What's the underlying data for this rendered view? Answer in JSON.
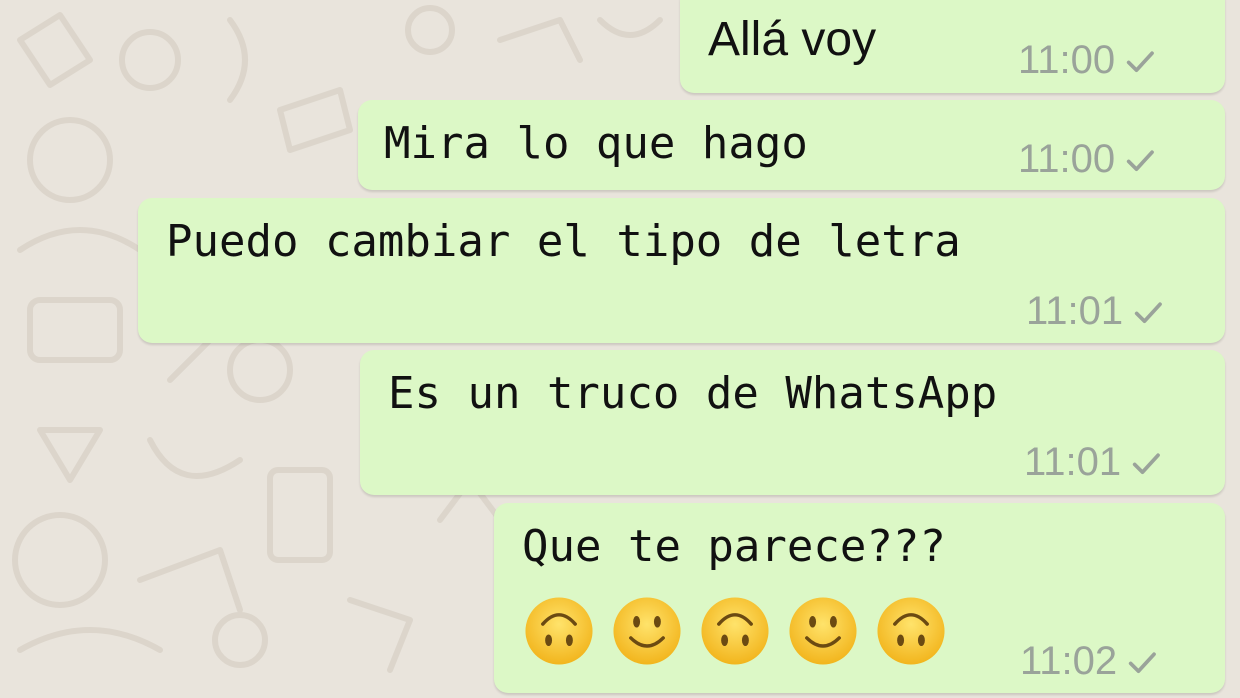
{
  "colors": {
    "bubble_outgoing": "#dcf8c6",
    "wallpaper": "#e9e4dc",
    "timestamp": "#9aa39a",
    "text": "#111111"
  },
  "messages": [
    {
      "text": "Allá voy",
      "time": "11:00",
      "status": "sent-check-icon"
    },
    {
      "text": "Mira lo que hago",
      "time": "11:00",
      "status": "sent-check-icon"
    },
    {
      "text": "Puedo cambiar el tipo de letra",
      "time": "11:01",
      "status": "sent-check-icon"
    },
    {
      "text": "Es un truco de WhatsApp",
      "time": "11:01",
      "status": "sent-check-icon"
    },
    {
      "text": "Que te parece???",
      "time": "11:02",
      "status": "sent-check-icon",
      "emojis": [
        "upside-down-face-icon",
        "slightly-smiling-face-icon",
        "upside-down-face-icon",
        "slightly-smiling-face-icon",
        "upside-down-face-icon"
      ]
    }
  ]
}
